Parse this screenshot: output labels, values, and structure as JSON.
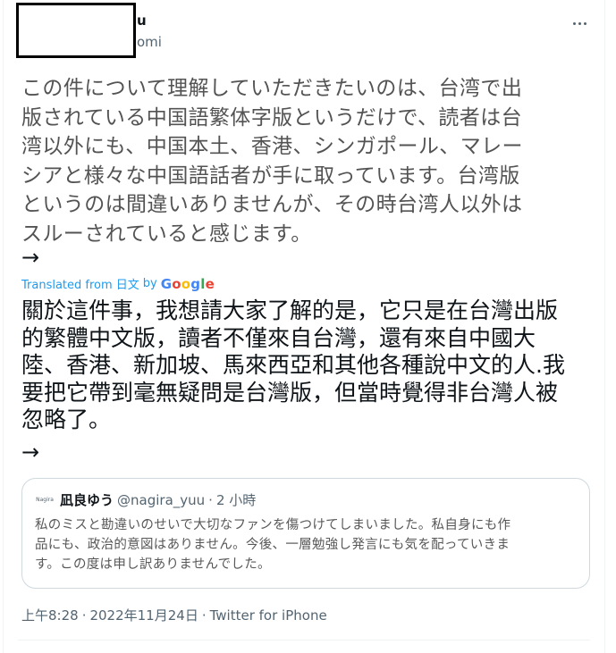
{
  "author": {
    "name_fragment": "u",
    "handle_fragment": "omi"
  },
  "icons": {
    "more": "more-options-icon",
    "arrow": "right-arrow-icon"
  },
  "tweet": {
    "text": "この件について理解していただきたいのは、台湾で出\n版されている中国語繁体字版というだけで、読者は台\n湾以外にも、中国本土、香港、シンガポール、マレー\nシアと様々な中国語話者が手に取っています。台湾版\nというのは間違いありませんが、その時台湾人以外は\nスルーされていると感じます。",
    "arrow": "→"
  },
  "translation": {
    "label": "Translated from 日文",
    "by": "by",
    "google": [
      "G",
      "o",
      "o",
      "g",
      "l",
      "e"
    ],
    "text": "關於這件事，我想請大家了解的是，它只是在台灣出版\n的繁體中文版，讀者不僅來自台灣，還有來自中國大\n陸、香港、新加坡、馬來西亞和其他各種說中文的人.我\n要把它帶到毫無疑問是台灣版，但當時覺得非台灣人被\n忽略了。",
    "arrow": "→"
  },
  "quoted_tweet": {
    "avatar_text": "Nagira",
    "name": "凪良ゆう",
    "handle": "@nagira_yuu",
    "separator": "·",
    "time": "2 小時",
    "text": "私のミスと勘違いのせいで大切なファンを傷つけてしまいました。私自身にも作\n品にも、政治的意図はありません。今後、一層勉強し発言にも気を配っていきま\nす。この度は申し訳ありませんでした。"
  },
  "meta": {
    "time": "上午8:28",
    "separator": "·",
    "date": "2022年11月24日",
    "source": "Twitter for iPhone"
  },
  "colors": {
    "link": "#1d9bf0",
    "secondary_text": "#536471",
    "border": "#cfd9de"
  }
}
